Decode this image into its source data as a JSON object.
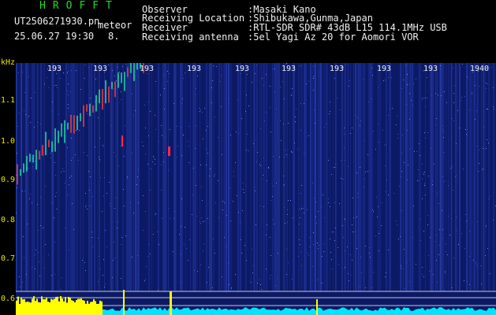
{
  "header": {
    "brand": "HROFFT",
    "filename": "UT2506271930.pn",
    "category": "meteor",
    "datetime": "25.06.27 19:30",
    "extra": "8."
  },
  "info": {
    "observer_label": "Observer",
    "observer_value": ":Masaki Kano",
    "location_label": "Receiving Location",
    "location_value": ":Shibukawa,Gunma,Japan",
    "receiver_label": "Receiver",
    "receiver_value": ":RTL-SDR SDR# 43dB L15 114.1MHz USB",
    "antenna_label": "Receiving antenna",
    "antenna_value": ":5el Yagi Az 20 for Aomori VOR"
  },
  "axis": {
    "unit": "kHz",
    "y_ticks": [
      "1.1",
      "1.0",
      "0.9",
      "0.8",
      "0.7",
      "0.6"
    ],
    "x_ticks": [
      "193",
      "193",
      "193",
      "193",
      "193",
      "193",
      "193",
      "193",
      "193",
      "1940"
    ]
  },
  "colors": {
    "background": "#0c1a66",
    "meteor": "#22ddaa",
    "signal_strength": "#00e5ff",
    "level_bars": "#ffff00"
  }
}
